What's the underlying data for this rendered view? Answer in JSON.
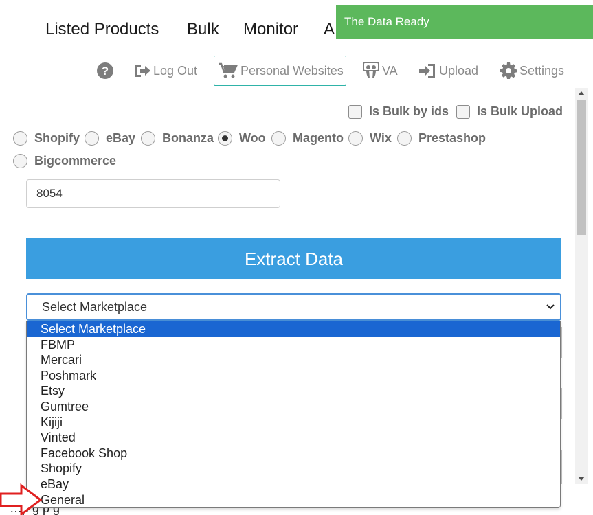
{
  "nav": {
    "items": [
      "Listed Products",
      "Bulk",
      "Monitor",
      "A"
    ]
  },
  "toast": {
    "message": "The Data Ready",
    "color": "#5cb85c"
  },
  "toolbar": {
    "help_icon": "question-circle-icon",
    "logout_label": "Log Out",
    "personal_websites_label": "Personal Websites",
    "va_label": "VA",
    "upload_label": "Upload",
    "settings_label": "Settings",
    "active_border_color": "#2fb3a8"
  },
  "options": {
    "bulk_by_ids_label": "Is Bulk by ids",
    "bulk_upload_label": "Is Bulk Upload"
  },
  "platforms": {
    "items": [
      "Shopify",
      "eBay",
      "Bonanza",
      "Woo",
      "Magento",
      "Wix",
      "Prestashop",
      "Bigcommerce"
    ],
    "selected": "Woo"
  },
  "id_input": {
    "value": "8054"
  },
  "extract": {
    "label": "Extract Data",
    "color": "#3a9ee0"
  },
  "marketplace": {
    "selected_label": "Select Marketplace",
    "options": [
      "Select Marketplace",
      "FBMP",
      "Mercari",
      "Poshmark",
      "Etsy",
      "Gumtree",
      "Kijiji",
      "Vinted",
      "Facebook Shop",
      "Shopify",
      "eBay",
      "General"
    ],
    "highlight_color": "#1a66d2"
  },
  "bottom": {
    "partial_text": "…p                    g         p     g"
  },
  "annotation": {
    "arrow_color": "#e02020"
  }
}
